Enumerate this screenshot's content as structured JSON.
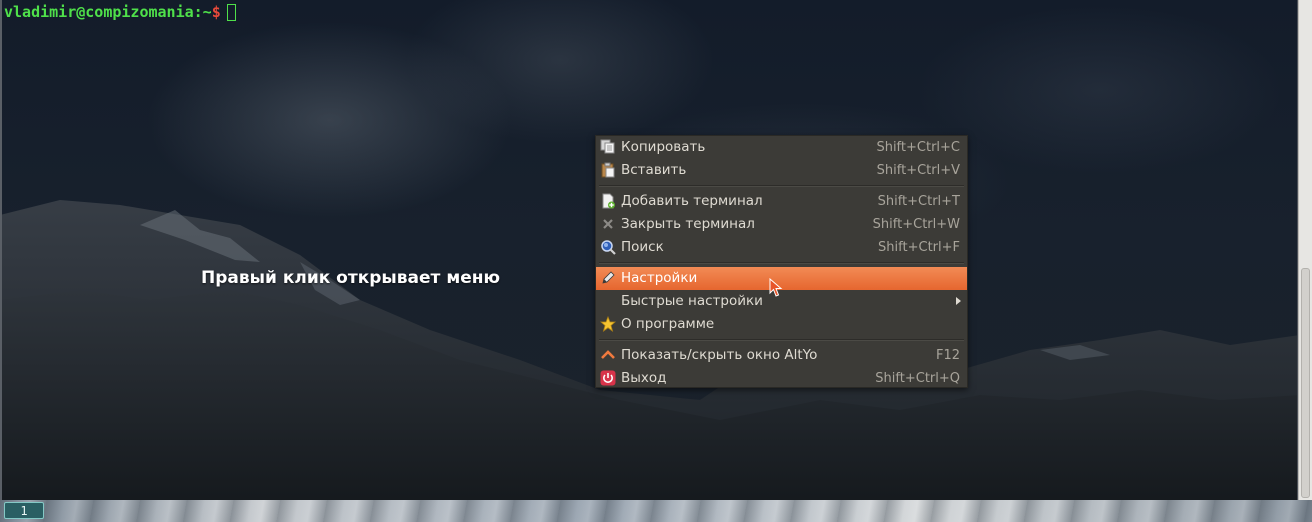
{
  "terminal": {
    "prompt_user": "vladimir@compizomania:~",
    "prompt_symbol": "$"
  },
  "caption": "Правый клик открывает меню",
  "tabbar": {
    "tabs": [
      {
        "label": "1",
        "active": true
      }
    ]
  },
  "context_menu": {
    "items": [
      {
        "label": "Копировать",
        "shortcut": "Shift+Ctrl+C",
        "icon": "copy-icon"
      },
      {
        "label": "Вставить",
        "shortcut": "Shift+Ctrl+V",
        "icon": "paste-icon"
      },
      {
        "label": "Добавить терминал",
        "shortcut": "Shift+Ctrl+T",
        "icon": "add-document-icon"
      },
      {
        "label": "Закрыть терминал",
        "shortcut": "Shift+Ctrl+W",
        "icon": "close-icon"
      },
      {
        "label": "Поиск",
        "shortcut": "Shift+Ctrl+F",
        "icon": "search-icon"
      },
      {
        "label": "Настройки",
        "shortcut": "",
        "icon": "pencil-icon",
        "highlighted": true
      },
      {
        "label": "Быстрые настройки",
        "shortcut": "",
        "icon": "",
        "submenu": true
      },
      {
        "label": "О программе",
        "shortcut": "",
        "icon": "star-icon"
      },
      {
        "label": "Показать/скрыть окно AltYo",
        "shortcut": "F12",
        "icon": "chevron-up-icon"
      },
      {
        "label": "Выход",
        "shortcut": "Shift+Ctrl+Q",
        "icon": "power-icon"
      }
    ]
  },
  "colors": {
    "prompt_green": "#4fe04a",
    "prompt_red": "#e84a3a",
    "menu_bg": "#3c3b37",
    "menu_highlight": "#e6662f",
    "tab_active": "#2a5f63"
  }
}
